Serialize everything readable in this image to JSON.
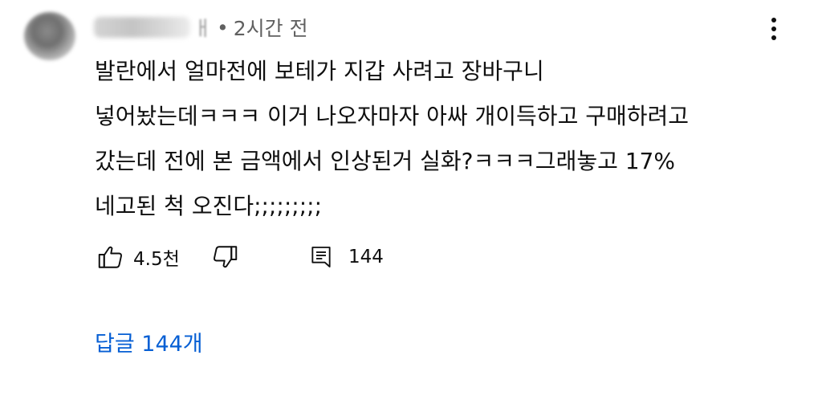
{
  "comment": {
    "author_visible_tail": "ㅐ",
    "separator": "•",
    "timestamp": "2시간 전",
    "body_lines": [
      "발란에서 얼마전에 보테가 지갑 사려고 장바구니",
      "넣어놨는데ㅋㅋㅋ 이거 나오자마자 아싸 개이득하고 구매하려고",
      "갔는데 전에 본 금액에서 인상된거 실화?ㅋㅋㅋ그래놓고 17%",
      "네고된 척 오진다;;;;;;;;;"
    ],
    "like_count": "4.5천",
    "reply_count": "144",
    "replies_link": "답글 144개"
  },
  "icons": {
    "more": "more-vert-icon",
    "like": "thumbs-up-icon",
    "dislike": "thumbs-down-icon",
    "reply": "comment-icon"
  },
  "colors": {
    "text": "#0f0f0f",
    "meta": "#606060",
    "link": "#065fd4"
  }
}
